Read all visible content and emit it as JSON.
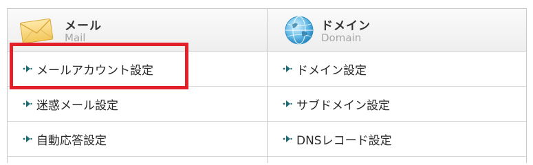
{
  "mail": {
    "title": "メール",
    "subtitle": "Mail",
    "items": [
      {
        "label": "メールアカウント設定"
      },
      {
        "label": "迷惑メール設定"
      },
      {
        "label": "自動応答設定"
      }
    ]
  },
  "domain": {
    "title": "ドメイン",
    "subtitle": "Domain",
    "items": [
      {
        "label": "ドメイン設定"
      },
      {
        "label": "サブドメイン設定"
      },
      {
        "label": "DNSレコード設定"
      }
    ]
  },
  "colors": {
    "highlight": "#e2202a",
    "arrow": "#1f6b74"
  },
  "icons": {
    "mail": "envelope-icon",
    "domain": "globe-icon",
    "row": "arrow-right-icon"
  }
}
